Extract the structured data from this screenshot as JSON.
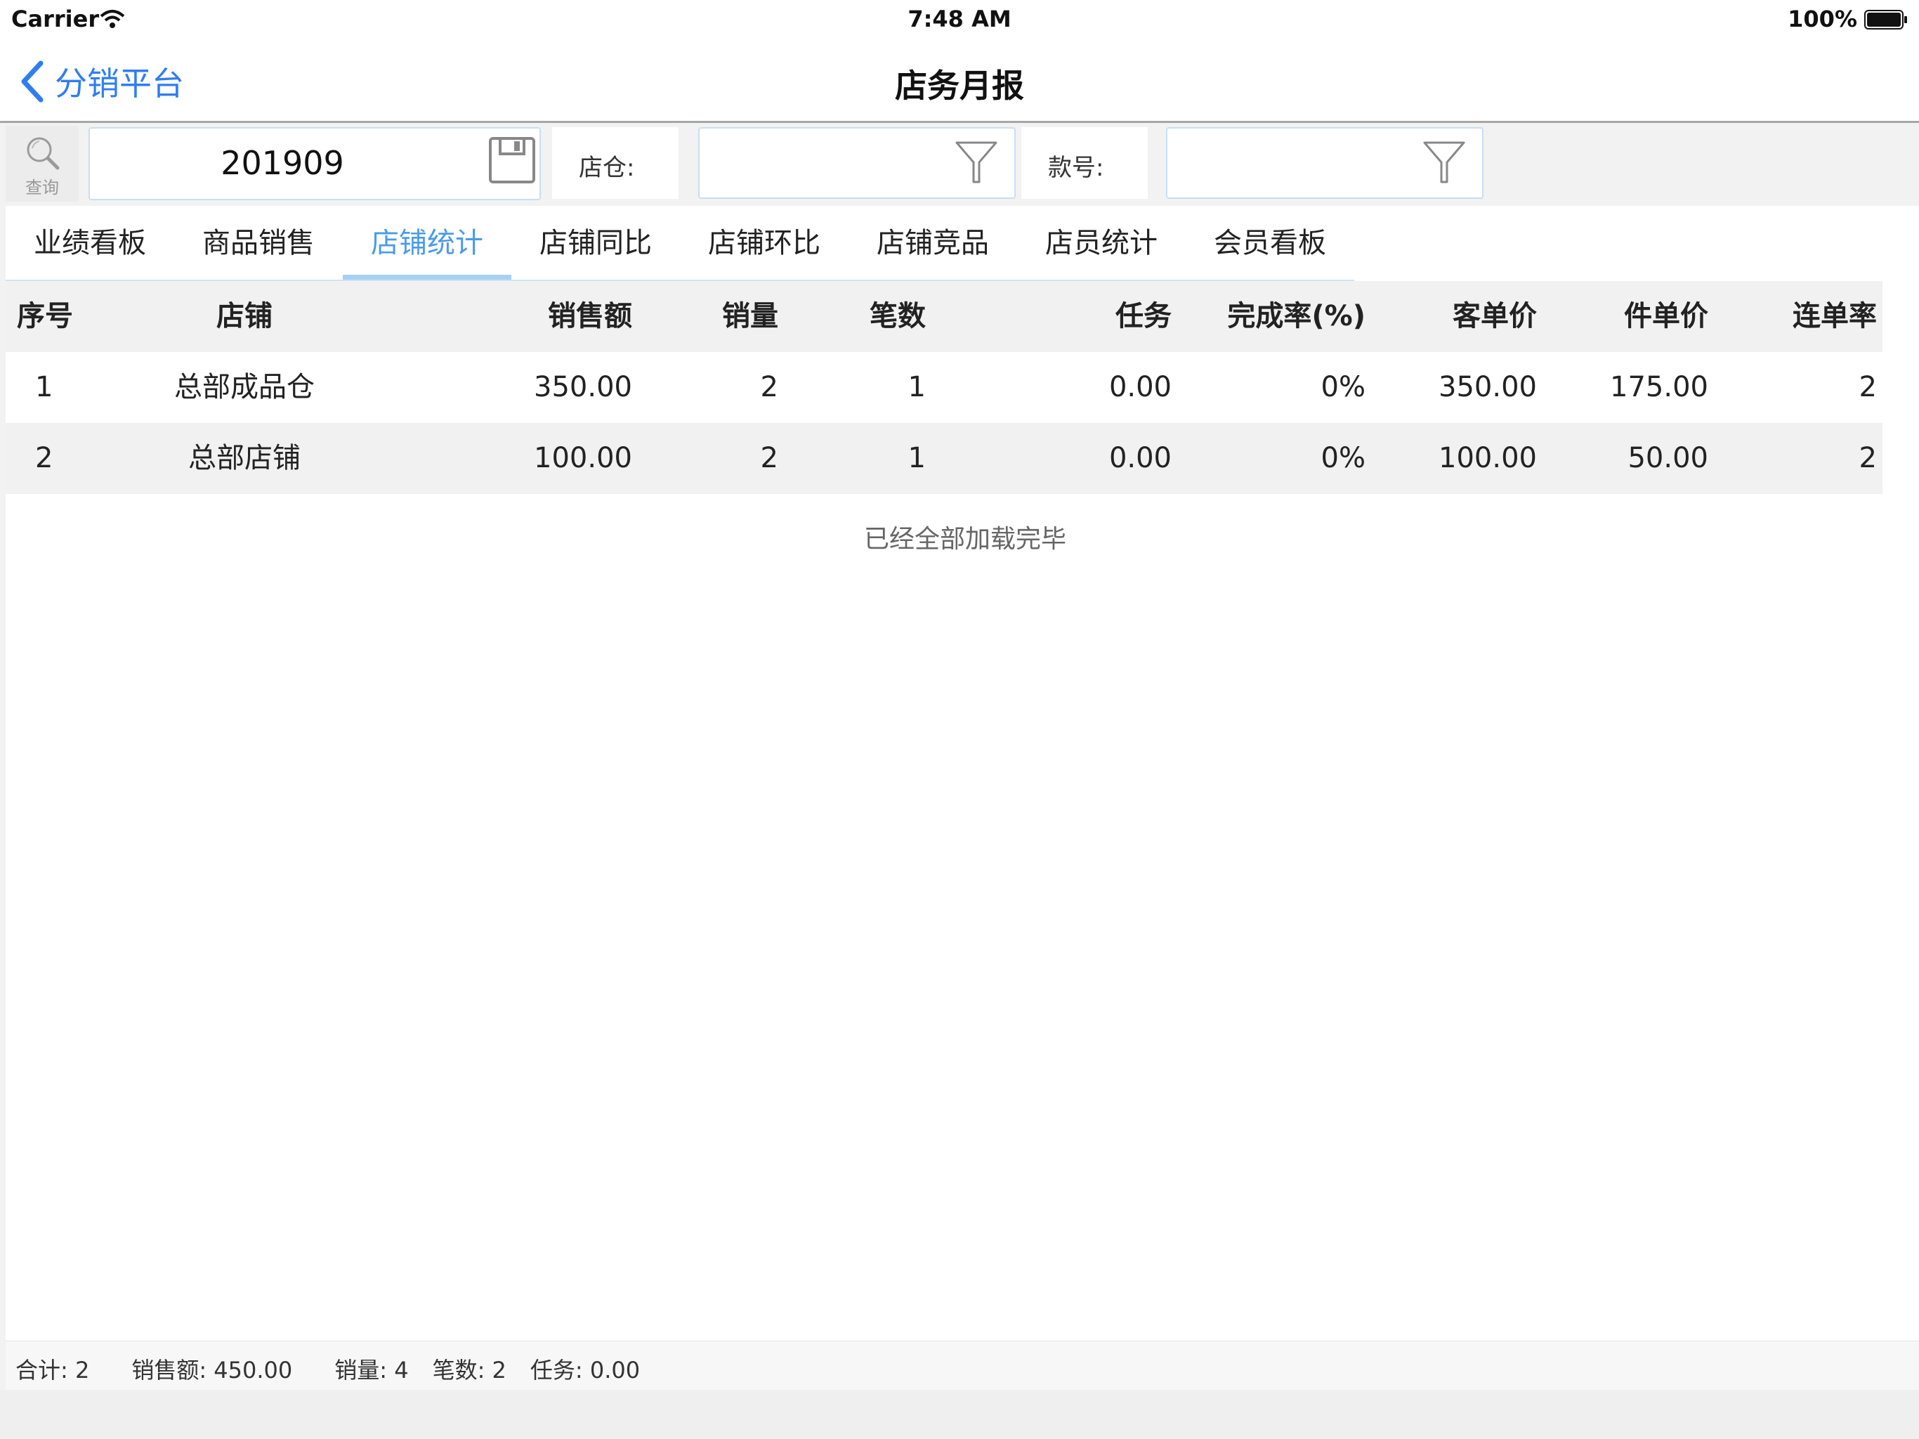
{
  "status_bar": {
    "carrier": "Carrier",
    "time": "7:48 AM",
    "battery": "100%"
  },
  "nav": {
    "back_label": "分销平台",
    "title": "店务月报"
  },
  "filters": {
    "query_label": "查询",
    "date_value": "201909",
    "store_label": "店仓:",
    "store_value": "",
    "style_label": "款号:",
    "style_value": ""
  },
  "tabs": [
    {
      "label": "业绩看板"
    },
    {
      "label": "商品销售"
    },
    {
      "label": "店铺统计",
      "active": true
    },
    {
      "label": "店铺同比"
    },
    {
      "label": "店铺环比"
    },
    {
      "label": "店铺竞品"
    },
    {
      "label": "店员统计"
    },
    {
      "label": "会员看板"
    }
  ],
  "table": {
    "columns": [
      "序号",
      "店铺",
      "销售额",
      "销量",
      "笔数",
      "任务",
      "完成率(%)",
      "客单价",
      "件单价",
      "连单率"
    ],
    "rows": [
      [
        "1",
        "总部成品仓",
        "350.00",
        "2",
        "1",
        "0.00",
        "0%",
        "350.00",
        "175.00",
        "2"
      ],
      [
        "2",
        "总部店铺",
        "100.00",
        "2",
        "1",
        "0.00",
        "0%",
        "100.00",
        "50.00",
        "2"
      ]
    ]
  },
  "loaded_text": "已经全部加载完毕",
  "footer": {
    "total": "合计: 2",
    "sales": "销售额: 450.00",
    "qty": "销量: 4",
    "count": "笔数: 2",
    "task": "任务: 0.00"
  },
  "colors": {
    "accent": "#2f7ef0",
    "tab_active": "#4a9be8",
    "tab_underline": "#a6d1f2",
    "row_alt": "#f1f1f1"
  }
}
